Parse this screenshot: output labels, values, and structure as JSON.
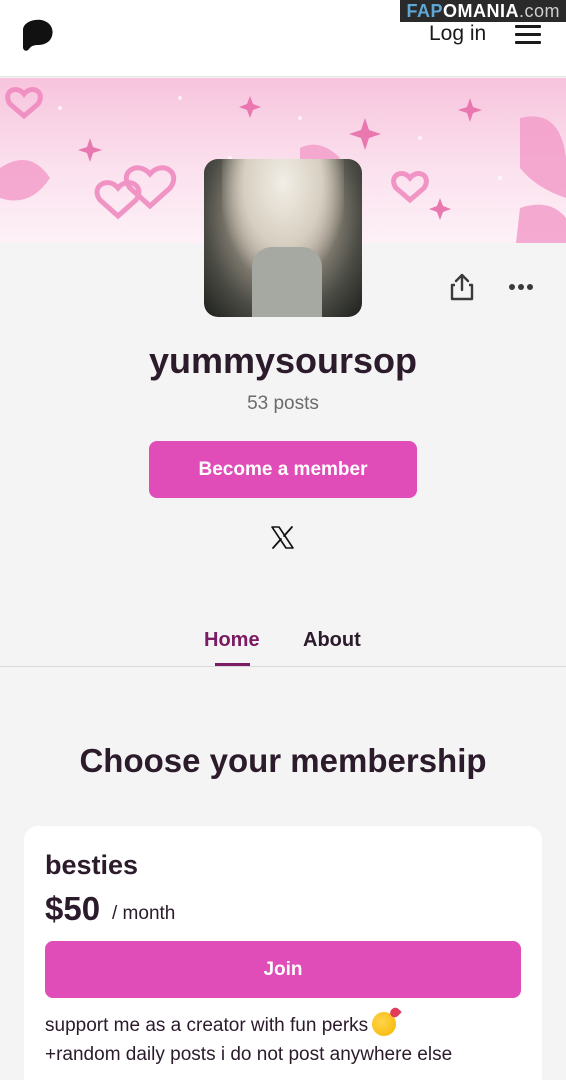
{
  "header": {
    "login_label": "Log in",
    "watermark": {
      "part1": "FAP",
      "part2": "OMANIA",
      "part3": ".com"
    }
  },
  "profile": {
    "name": "yummysoursop",
    "posts": "53 posts",
    "cta_label": "Become a member",
    "social": [
      "x-icon"
    ]
  },
  "tabs": [
    {
      "label": "Home",
      "active": true
    },
    {
      "label": "About",
      "active": false
    }
  ],
  "membership": {
    "title": "Choose your membership",
    "tiers": [
      {
        "name": "besties",
        "price": "$50",
        "period": "/ month",
        "join_label": "Join",
        "description_line1": "support me as a creator with fun perks",
        "description_line2": "+random daily posts i do not post anywhere else"
      }
    ]
  },
  "colors": {
    "accent": "#e04cb8",
    "tab_active": "#7a1b63",
    "text_dark": "#2b1b2b",
    "banner_pink": "#f7c4dd"
  },
  "icons": [
    "patreon-logo-icon",
    "hamburger-menu-icon",
    "share-icon",
    "more-options-icon",
    "x-icon",
    "smiling-hearts-emoji-icon"
  ]
}
